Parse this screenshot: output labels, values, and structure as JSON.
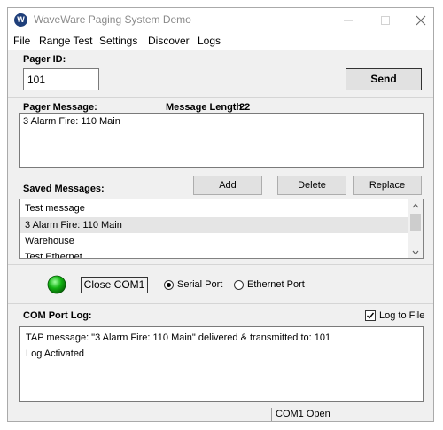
{
  "window": {
    "title": "WaveWare Paging System Demo",
    "app_icon_glyph": "W",
    "app_icon_color": "#1f3f7a"
  },
  "menu": [
    "File",
    "Range Test",
    "Settings",
    "Discover",
    "Logs"
  ],
  "pager": {
    "id_label": "Pager ID:",
    "id_value": "101",
    "send_label": "Send"
  },
  "message": {
    "label": "Pager Message:",
    "length_label": "Message Length:",
    "length_value": "22",
    "text": "3 Alarm Fire: 110 Main"
  },
  "saved": {
    "label": "Saved Messages:",
    "add_label": "Add",
    "delete_label": "Delete",
    "replace_label": "Replace",
    "items": [
      "Test message",
      "3 Alarm Fire: 110 Main",
      "Warehouse",
      "Test Ethernet"
    ],
    "selected_index": 1
  },
  "connection": {
    "indicator_color": "#12b312",
    "close_label": "Close COM1",
    "serial_label": "Serial Port",
    "ethernet_label": "Ethernet Port",
    "selected": "serial"
  },
  "log": {
    "label": "COM Port Log:",
    "log_to_file_label": "Log to File",
    "log_to_file_checked": true,
    "lines": [
      "TAP message: \"3 Alarm Fire: 110 Main\" delivered & transmitted to: 101",
      "Log Activated"
    ]
  },
  "status": {
    "text": "COM1 Open"
  }
}
